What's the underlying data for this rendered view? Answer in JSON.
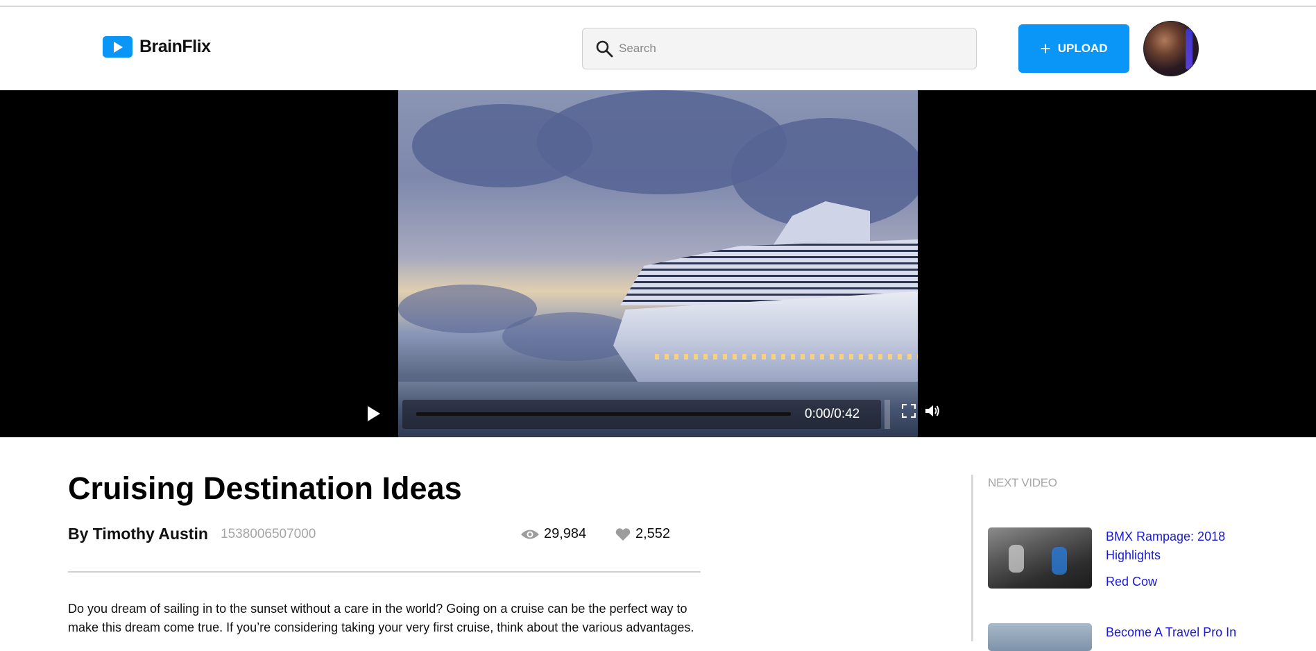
{
  "app": {
    "name": "BrainFlix"
  },
  "colors": {
    "accent": "#0a96f7",
    "link": "#1a1ad6",
    "muted": "#a6a6a6"
  },
  "header": {
    "search_placeholder": "Search",
    "upload_label": "UPLOAD",
    "upload_icon": "plus-icon"
  },
  "player": {
    "time": "0:00/0:42",
    "progress_fraction": 0,
    "icons": [
      "play-icon",
      "fullscreen-icon",
      "volume-icon"
    ]
  },
  "video": {
    "title": "Cruising Destination Ideas",
    "author": "By Timothy Austin",
    "timestamp": "1538006507000",
    "views": "29,984",
    "likes": "2,552",
    "description": "Do you dream of sailing in to the sunset without a care in the world? Going on a cruise can be the perfect way to make this dream come true. If you’re considering taking your very first cruise, think about the various advantages."
  },
  "sidebar": {
    "label": "NEXT VIDEO",
    "items": [
      {
        "title": "BMX Rampage: 2018 Highlights",
        "channel": "Red Cow"
      },
      {
        "title": "Become A Travel Pro In"
      }
    ]
  }
}
